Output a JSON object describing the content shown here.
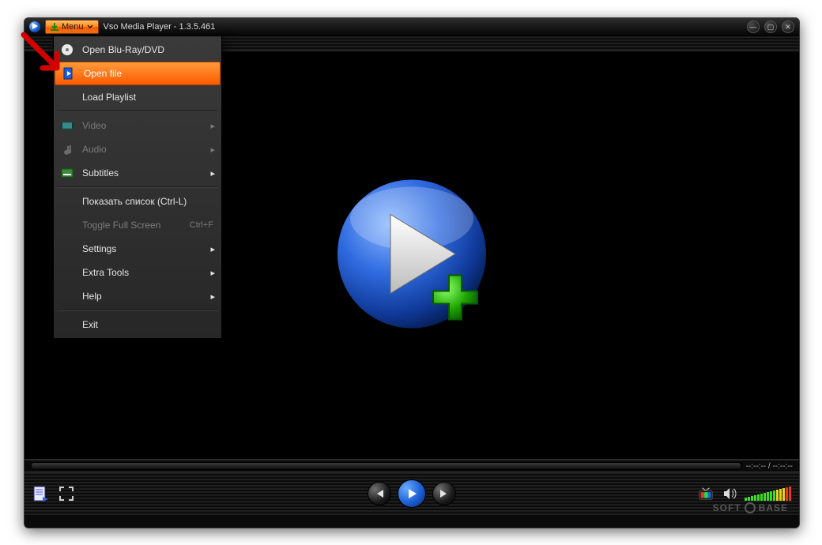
{
  "titlebar": {
    "menu_btn_label": "Menu",
    "app_title": "Vso Media Player - 1.3.5.461"
  },
  "menu": {
    "items": [
      {
        "label": "Open Blu-Ray/DVD",
        "icon": "disc-icon"
      },
      {
        "label": "Open file",
        "icon": "file-play-icon",
        "selected": true
      },
      {
        "label": "Load Playlist"
      },
      {
        "sep": true
      },
      {
        "label": "Video",
        "icon": "video-icon",
        "submenu": true,
        "disabled": true
      },
      {
        "label": "Audio",
        "icon": "audio-icon",
        "submenu": true,
        "disabled": true
      },
      {
        "label": "Subtitles",
        "icon": "subtitle-icon",
        "submenu": true
      },
      {
        "sep": true
      },
      {
        "label": "Показать список (Ctrl-L)"
      },
      {
        "label": "Toggle Full Screen",
        "accel": "Ctrl+F",
        "disabled": true
      },
      {
        "label": "Settings",
        "submenu": true
      },
      {
        "label": "Extra Tools",
        "submenu": true
      },
      {
        "label": "Help",
        "submenu": true
      },
      {
        "sep": true
      },
      {
        "label": "Exit"
      }
    ]
  },
  "progress": {
    "time_display": "--:--:-- / --:--:--"
  },
  "watermark": {
    "left": "SOFT",
    "right": "BASE"
  },
  "volume": {
    "bars": 15
  }
}
